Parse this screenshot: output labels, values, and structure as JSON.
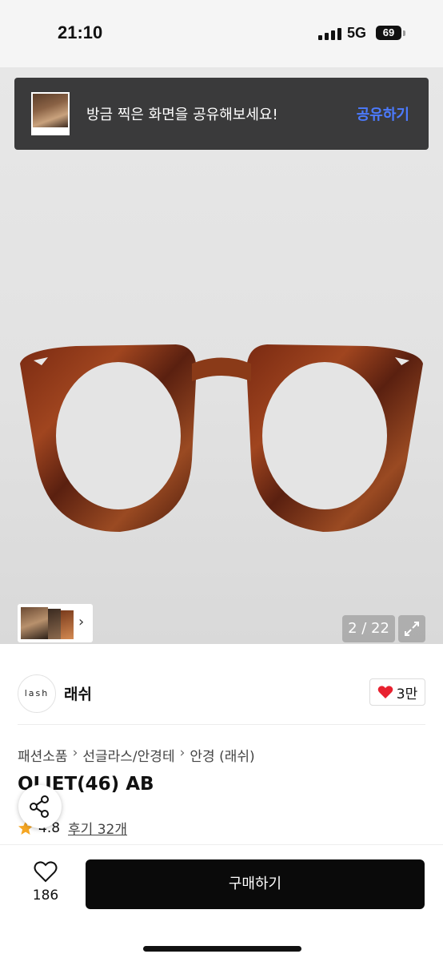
{
  "status_bar": {
    "time": "21:10",
    "network": "5G",
    "battery": "69"
  },
  "share_toast": {
    "message": "방금 찍은 화면을 공유해보세요!",
    "action": "공유하기"
  },
  "gallery": {
    "counter": "2 / 22"
  },
  "seller": {
    "logo_text": "lash",
    "name": "래쉬",
    "likes": "3만"
  },
  "breadcrumb": [
    "패션소품",
    "선글라스/안경테",
    "안경 (래쉬)"
  ],
  "product": {
    "title": "OLIET(46) AB",
    "rating": "4.8",
    "reviews": "후기 32개"
  },
  "bottom_bar": {
    "wish_count": "186",
    "buy_label": "구매하기"
  },
  "icons": [
    "signal-icon",
    "battery-icon",
    "chevron-right-icon",
    "expand-icon",
    "heart-icon",
    "star-icon",
    "share-icon",
    "heart-outline-icon"
  ],
  "colors": {
    "toast_bg": "#3a3a3b",
    "toast_action": "#4c7bff",
    "buy_button": "#0a0a0a",
    "heart": "#e8212f",
    "star": "#f5a623"
  }
}
